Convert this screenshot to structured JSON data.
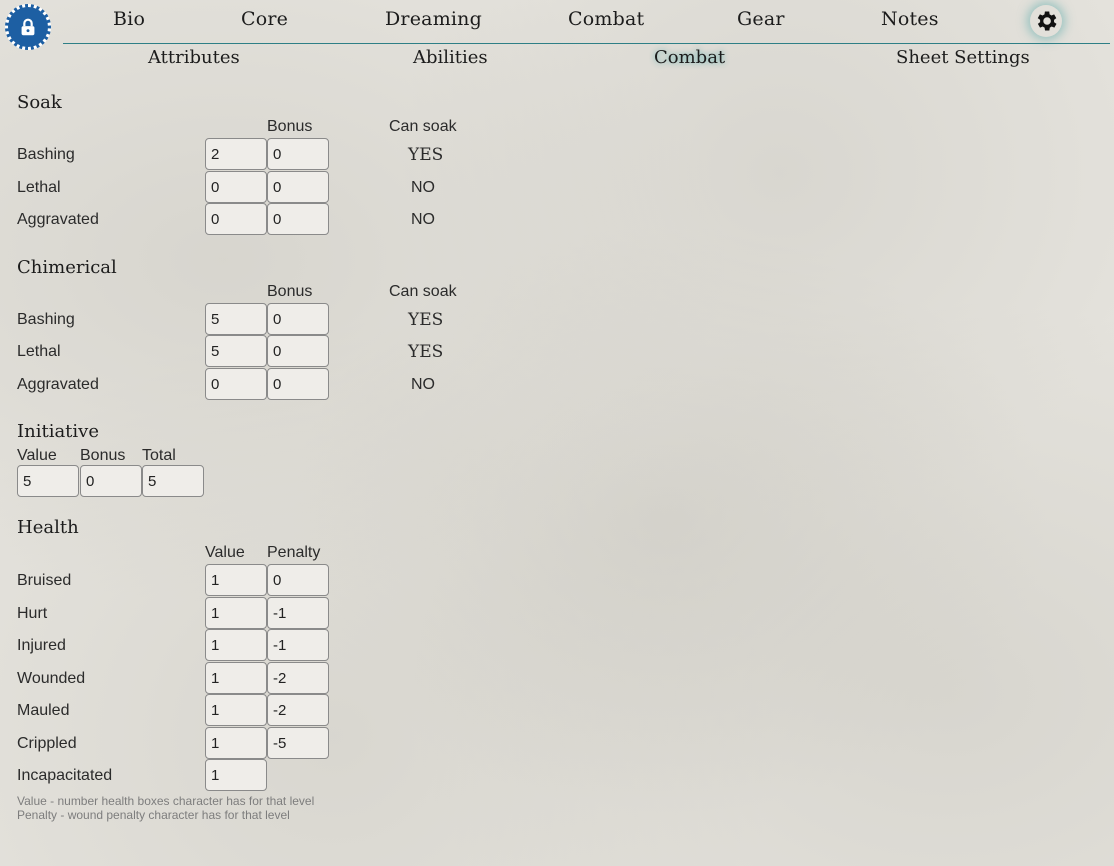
{
  "nav": {
    "tabs": [
      "Bio",
      "Core",
      "Dreaming",
      "Combat",
      "Gear",
      "Notes"
    ],
    "active": "Combat"
  },
  "subnav": {
    "tabs": [
      "Attributes",
      "Abilities",
      "Combat",
      "Sheet Settings"
    ],
    "active": "Combat"
  },
  "soak": {
    "title": "Soak",
    "bonus_header": "Bonus",
    "can_soak_header": "Can soak",
    "rows": [
      {
        "label": "Bashing",
        "value": "2",
        "bonus": "0",
        "can_soak": "YES"
      },
      {
        "label": "Lethal",
        "value": "0",
        "bonus": "0",
        "can_soak": "NO"
      },
      {
        "label": "Aggravated",
        "value": "0",
        "bonus": "0",
        "can_soak": "NO"
      }
    ]
  },
  "chimerical": {
    "title": "Chimerical",
    "bonus_header": "Bonus",
    "can_soak_header": "Can soak",
    "rows": [
      {
        "label": "Bashing",
        "value": "5",
        "bonus": "0",
        "can_soak": "YES"
      },
      {
        "label": "Lethal",
        "value": "5",
        "bonus": "0",
        "can_soak": "YES"
      },
      {
        "label": "Aggravated",
        "value": "0",
        "bonus": "0",
        "can_soak": "NO"
      }
    ]
  },
  "initiative": {
    "title": "Initiative",
    "value_header": "Value",
    "bonus_header": "Bonus",
    "total_header": "Total",
    "value": "5",
    "bonus": "0",
    "total": "5"
  },
  "health": {
    "title": "Health",
    "value_header": "Value",
    "penalty_header": "Penalty",
    "rows": [
      {
        "label": "Bruised",
        "value": "1",
        "penalty": "0"
      },
      {
        "label": "Hurt",
        "value": "1",
        "penalty": "-1"
      },
      {
        "label": "Injured",
        "value": "1",
        "penalty": "-1"
      },
      {
        "label": "Wounded",
        "value": "1",
        "penalty": "-2"
      },
      {
        "label": "Mauled",
        "value": "1",
        "penalty": "-2"
      },
      {
        "label": "Crippled",
        "value": "1",
        "penalty": "-5"
      },
      {
        "label": "Incapacitated",
        "value": "1"
      }
    ],
    "notes": [
      "Value - number health boxes character has for that level",
      "Penalty - wound penalty character has for that level"
    ]
  },
  "colors": {
    "accent": "#2e7f86",
    "lock_badge": "#1d5fa3"
  }
}
